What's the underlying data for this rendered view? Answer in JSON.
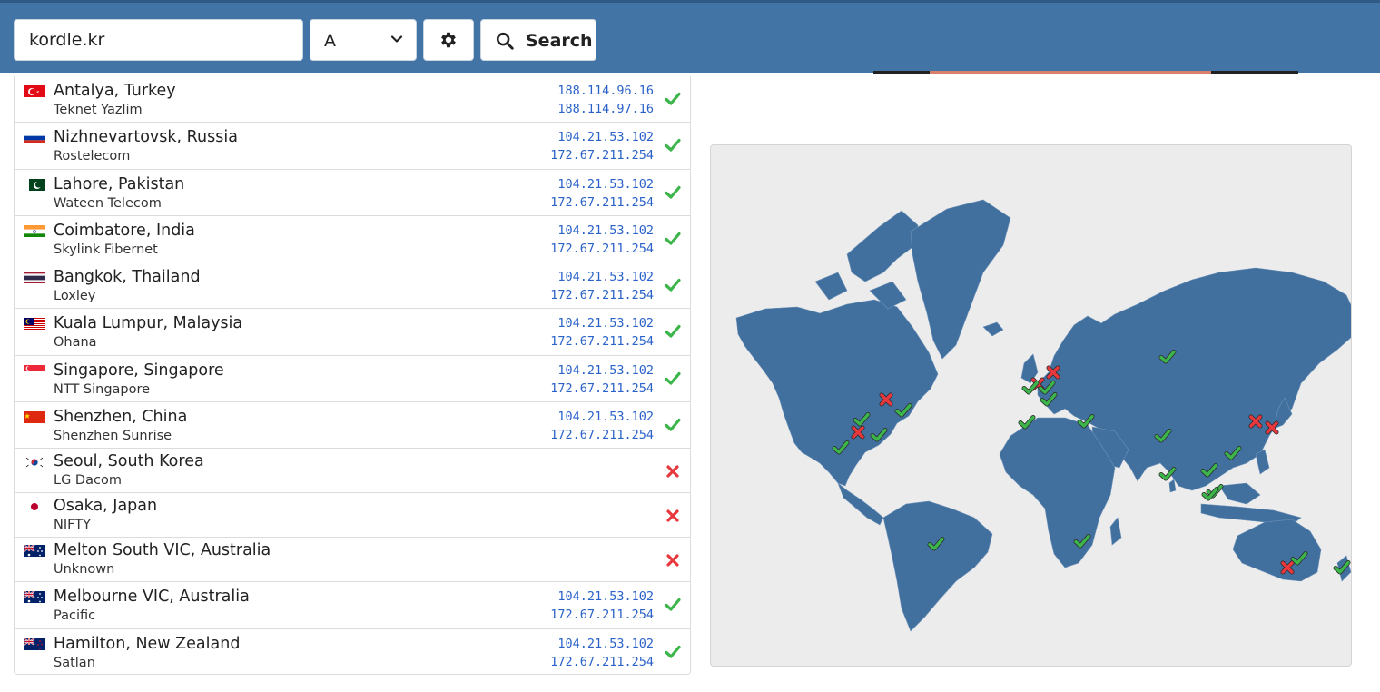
{
  "toolbar": {
    "query_value": "kordle.kr",
    "record_type": "A",
    "search_label": "Search"
  },
  "results": [
    {
      "city": "Antalya, Turkey",
      "isp": "Teknet Yazlim",
      "ip1": "188.114.96.16",
      "ip2": "188.114.97.16",
      "status": "ok",
      "flag": "tr"
    },
    {
      "city": "Nizhnevartovsk, Russia",
      "isp": "Rostelecom",
      "ip1": "104.21.53.102",
      "ip2": "172.67.211.254",
      "status": "ok",
      "flag": "ru"
    },
    {
      "city": "Lahore, Pakistan",
      "isp": "Wateen Telecom",
      "ip1": "104.21.53.102",
      "ip2": "172.67.211.254",
      "status": "ok",
      "flag": "pk"
    },
    {
      "city": "Coimbatore, India",
      "isp": "Skylink Fibernet",
      "ip1": "104.21.53.102",
      "ip2": "172.67.211.254",
      "status": "ok",
      "flag": "in"
    },
    {
      "city": "Bangkok, Thailand",
      "isp": "Loxley",
      "ip1": "104.21.53.102",
      "ip2": "172.67.211.254",
      "status": "ok",
      "flag": "th"
    },
    {
      "city": "Kuala Lumpur, Malaysia",
      "isp": "Ohana",
      "ip1": "104.21.53.102",
      "ip2": "172.67.211.254",
      "status": "ok",
      "flag": "my"
    },
    {
      "city": "Singapore, Singapore",
      "isp": "NTT Singapore",
      "ip1": "104.21.53.102",
      "ip2": "172.67.211.254",
      "status": "ok",
      "flag": "sg"
    },
    {
      "city": "Shenzhen, China",
      "isp": "Shenzhen Sunrise",
      "ip1": "104.21.53.102",
      "ip2": "172.67.211.254",
      "status": "ok",
      "flag": "cn"
    },
    {
      "city": "Seoul, South Korea",
      "isp": "LG Dacom",
      "ip1": "",
      "ip2": "",
      "status": "fail",
      "flag": "kr"
    },
    {
      "city": "Osaka, Japan",
      "isp": "NIFTY",
      "ip1": "",
      "ip2": "",
      "status": "fail",
      "flag": "jp"
    },
    {
      "city": "Melton South VIC, Australia",
      "isp": "Unknown",
      "ip1": "",
      "ip2": "",
      "status": "fail",
      "flag": "au"
    },
    {
      "city": "Melbourne VIC, Australia",
      "isp": "Pacific",
      "ip1": "104.21.53.102",
      "ip2": "172.67.211.254",
      "status": "ok",
      "flag": "au"
    },
    {
      "city": "Hamilton, New Zealand",
      "isp": "Satlan",
      "ip1": "104.21.53.102",
      "ip2": "172.67.211.254",
      "status": "ok",
      "flag": "nz"
    }
  ],
  "colors": {
    "header_bg": "#4274a6",
    "land": "#41709f",
    "ok": "#3cb54a",
    "fail": "#e8383d",
    "ip_text": "#2a62c9"
  },
  "icons": [
    "gear-icon",
    "search-icon",
    "chevron-down-icon",
    "check-icon",
    "cross-icon"
  ]
}
